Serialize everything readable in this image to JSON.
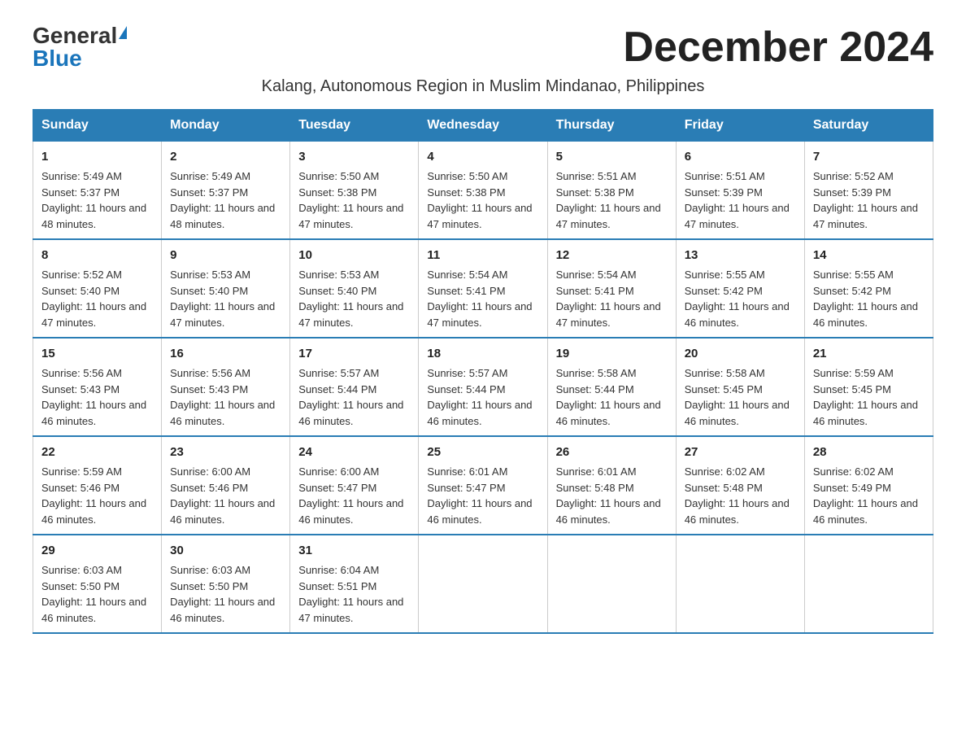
{
  "logo": {
    "general": "General",
    "blue": "Blue"
  },
  "title": "December 2024",
  "subtitle": "Kalang, Autonomous Region in Muslim Mindanao, Philippines",
  "days_of_week": [
    "Sunday",
    "Monday",
    "Tuesday",
    "Wednesday",
    "Thursday",
    "Friday",
    "Saturday"
  ],
  "weeks": [
    [
      {
        "day": "1",
        "sunrise": "5:49 AM",
        "sunset": "5:37 PM",
        "daylight": "11 hours and 48 minutes."
      },
      {
        "day": "2",
        "sunrise": "5:49 AM",
        "sunset": "5:37 PM",
        "daylight": "11 hours and 48 minutes."
      },
      {
        "day": "3",
        "sunrise": "5:50 AM",
        "sunset": "5:38 PM",
        "daylight": "11 hours and 47 minutes."
      },
      {
        "day": "4",
        "sunrise": "5:50 AM",
        "sunset": "5:38 PM",
        "daylight": "11 hours and 47 minutes."
      },
      {
        "day": "5",
        "sunrise": "5:51 AM",
        "sunset": "5:38 PM",
        "daylight": "11 hours and 47 minutes."
      },
      {
        "day": "6",
        "sunrise": "5:51 AM",
        "sunset": "5:39 PM",
        "daylight": "11 hours and 47 minutes."
      },
      {
        "day": "7",
        "sunrise": "5:52 AM",
        "sunset": "5:39 PM",
        "daylight": "11 hours and 47 minutes."
      }
    ],
    [
      {
        "day": "8",
        "sunrise": "5:52 AM",
        "sunset": "5:40 PM",
        "daylight": "11 hours and 47 minutes."
      },
      {
        "day": "9",
        "sunrise": "5:53 AM",
        "sunset": "5:40 PM",
        "daylight": "11 hours and 47 minutes."
      },
      {
        "day": "10",
        "sunrise": "5:53 AM",
        "sunset": "5:40 PM",
        "daylight": "11 hours and 47 minutes."
      },
      {
        "day": "11",
        "sunrise": "5:54 AM",
        "sunset": "5:41 PM",
        "daylight": "11 hours and 47 minutes."
      },
      {
        "day": "12",
        "sunrise": "5:54 AM",
        "sunset": "5:41 PM",
        "daylight": "11 hours and 47 minutes."
      },
      {
        "day": "13",
        "sunrise": "5:55 AM",
        "sunset": "5:42 PM",
        "daylight": "11 hours and 46 minutes."
      },
      {
        "day": "14",
        "sunrise": "5:55 AM",
        "sunset": "5:42 PM",
        "daylight": "11 hours and 46 minutes."
      }
    ],
    [
      {
        "day": "15",
        "sunrise": "5:56 AM",
        "sunset": "5:43 PM",
        "daylight": "11 hours and 46 minutes."
      },
      {
        "day": "16",
        "sunrise": "5:56 AM",
        "sunset": "5:43 PM",
        "daylight": "11 hours and 46 minutes."
      },
      {
        "day": "17",
        "sunrise": "5:57 AM",
        "sunset": "5:44 PM",
        "daylight": "11 hours and 46 minutes."
      },
      {
        "day": "18",
        "sunrise": "5:57 AM",
        "sunset": "5:44 PM",
        "daylight": "11 hours and 46 minutes."
      },
      {
        "day": "19",
        "sunrise": "5:58 AM",
        "sunset": "5:44 PM",
        "daylight": "11 hours and 46 minutes."
      },
      {
        "day": "20",
        "sunrise": "5:58 AM",
        "sunset": "5:45 PM",
        "daylight": "11 hours and 46 minutes."
      },
      {
        "day": "21",
        "sunrise": "5:59 AM",
        "sunset": "5:45 PM",
        "daylight": "11 hours and 46 minutes."
      }
    ],
    [
      {
        "day": "22",
        "sunrise": "5:59 AM",
        "sunset": "5:46 PM",
        "daylight": "11 hours and 46 minutes."
      },
      {
        "day": "23",
        "sunrise": "6:00 AM",
        "sunset": "5:46 PM",
        "daylight": "11 hours and 46 minutes."
      },
      {
        "day": "24",
        "sunrise": "6:00 AM",
        "sunset": "5:47 PM",
        "daylight": "11 hours and 46 minutes."
      },
      {
        "day": "25",
        "sunrise": "6:01 AM",
        "sunset": "5:47 PM",
        "daylight": "11 hours and 46 minutes."
      },
      {
        "day": "26",
        "sunrise": "6:01 AM",
        "sunset": "5:48 PM",
        "daylight": "11 hours and 46 minutes."
      },
      {
        "day": "27",
        "sunrise": "6:02 AM",
        "sunset": "5:48 PM",
        "daylight": "11 hours and 46 minutes."
      },
      {
        "day": "28",
        "sunrise": "6:02 AM",
        "sunset": "5:49 PM",
        "daylight": "11 hours and 46 minutes."
      }
    ],
    [
      {
        "day": "29",
        "sunrise": "6:03 AM",
        "sunset": "5:50 PM",
        "daylight": "11 hours and 46 minutes."
      },
      {
        "day": "30",
        "sunrise": "6:03 AM",
        "sunset": "5:50 PM",
        "daylight": "11 hours and 46 minutes."
      },
      {
        "day": "31",
        "sunrise": "6:04 AM",
        "sunset": "5:51 PM",
        "daylight": "11 hours and 47 minutes."
      },
      null,
      null,
      null,
      null
    ]
  ]
}
